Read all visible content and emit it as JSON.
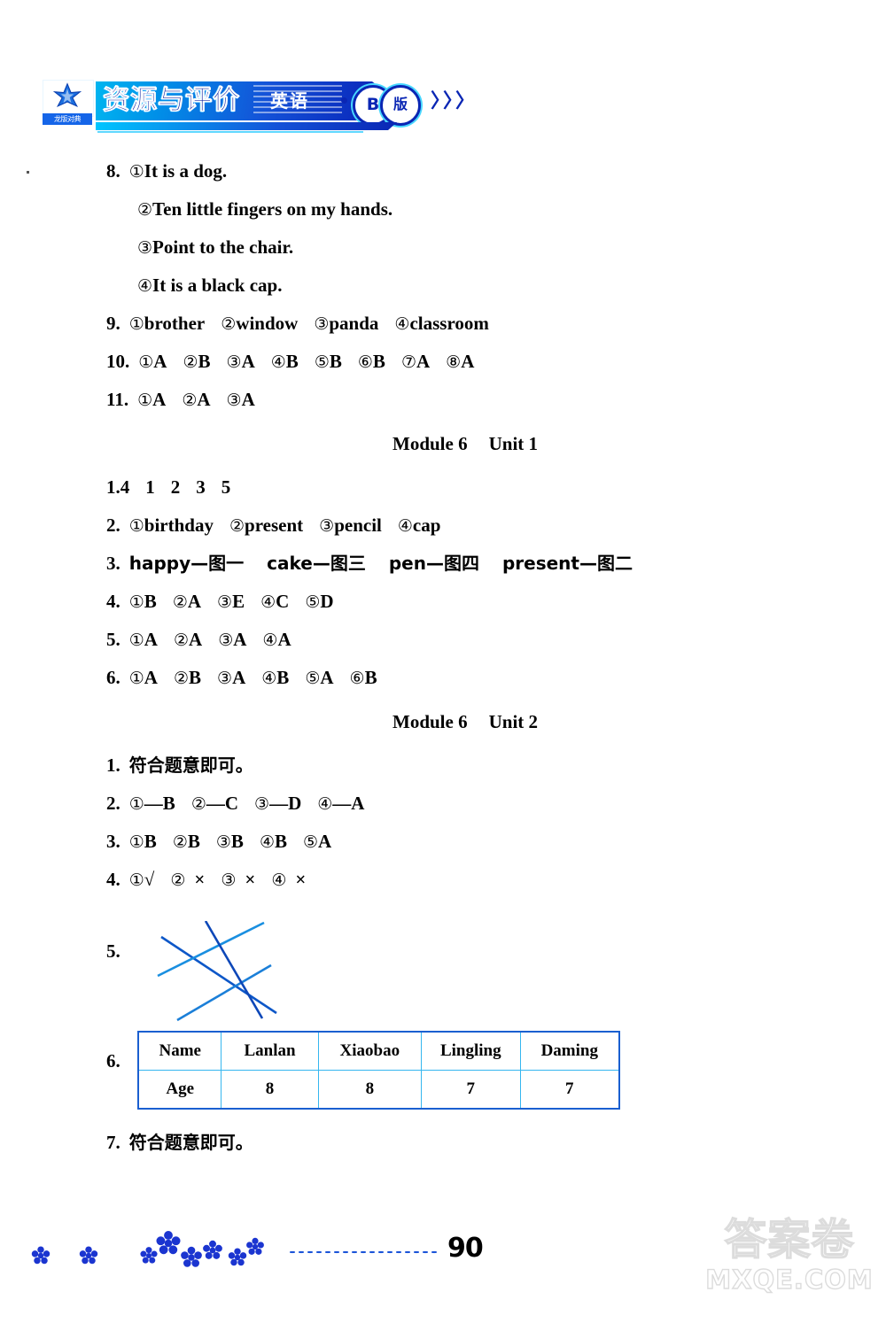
{
  "header": {
    "logo_star": "star-logo",
    "logo_caption": "龙版对典",
    "title": "资源与评价",
    "subject": "英语",
    "badge_b": "B",
    "badge_ban": "版",
    "chevrons": "〉〉〉"
  },
  "answers": {
    "q8": {
      "num": "8.",
      "items": [
        {
          "marker": "①",
          "text": "It is a dog."
        },
        {
          "marker": "②",
          "text": "Ten little fingers on my hands."
        },
        {
          "marker": "③",
          "text": "Point to the chair."
        },
        {
          "marker": "④",
          "text": "It is a black cap."
        }
      ]
    },
    "q9": {
      "num": "9.",
      "items": [
        {
          "marker": "①",
          "text": "brother"
        },
        {
          "marker": "②",
          "text": "window"
        },
        {
          "marker": "③",
          "text": "panda"
        },
        {
          "marker": "④",
          "text": "classroom"
        }
      ]
    },
    "q10": {
      "num": "10.",
      "items": [
        {
          "marker": "①",
          "text": "A"
        },
        {
          "marker": "②",
          "text": "B"
        },
        {
          "marker": "③",
          "text": "A"
        },
        {
          "marker": "④",
          "text": "B"
        },
        {
          "marker": "⑤",
          "text": "B"
        },
        {
          "marker": "⑥",
          "text": "B"
        },
        {
          "marker": "⑦",
          "text": "A"
        },
        {
          "marker": "⑧",
          "text": "A"
        }
      ]
    },
    "q11": {
      "num": "11.",
      "items": [
        {
          "marker": "①",
          "text": "A"
        },
        {
          "marker": "②",
          "text": "A"
        },
        {
          "marker": "③",
          "text": "A"
        }
      ]
    }
  },
  "module6_unit1": {
    "heading_module": "Module 6",
    "heading_unit": "Unit 1",
    "q1": {
      "num": "1.",
      "values": [
        "4",
        "1",
        "2",
        "3",
        "5"
      ]
    },
    "q2": {
      "num": "2.",
      "items": [
        {
          "marker": "①",
          "text": "birthday"
        },
        {
          "marker": "②",
          "text": "present"
        },
        {
          "marker": "③",
          "text": "pencil"
        },
        {
          "marker": "④",
          "text": "cap"
        }
      ]
    },
    "q3": {
      "num": "3.",
      "pairs": [
        "happy—图一",
        "cake—图三",
        "pen—图四",
        "present—图二"
      ]
    },
    "q4": {
      "num": "4.",
      "items": [
        {
          "marker": "①",
          "text": "B"
        },
        {
          "marker": "②",
          "text": "A"
        },
        {
          "marker": "③",
          "text": "E"
        },
        {
          "marker": "④",
          "text": "C"
        },
        {
          "marker": "⑤",
          "text": "D"
        }
      ]
    },
    "q5": {
      "num": "5.",
      "items": [
        {
          "marker": "①",
          "text": "A"
        },
        {
          "marker": "②",
          "text": "A"
        },
        {
          "marker": "③",
          "text": "A"
        },
        {
          "marker": "④",
          "text": "A"
        }
      ]
    },
    "q6": {
      "num": "6.",
      "items": [
        {
          "marker": "①",
          "text": "A"
        },
        {
          "marker": "②",
          "text": "B"
        },
        {
          "marker": "③",
          "text": "A"
        },
        {
          "marker": "④",
          "text": "B"
        },
        {
          "marker": "⑤",
          "text": "A"
        },
        {
          "marker": "⑥",
          "text": "B"
        }
      ]
    }
  },
  "module6_unit2": {
    "heading_module": "Module 6",
    "heading_unit": "Unit 2",
    "q1": {
      "num": "1.",
      "text": "符合题意即可。"
    },
    "q2": {
      "num": "2.",
      "items": [
        {
          "marker": "①",
          "text": "—B"
        },
        {
          "marker": "②",
          "text": "—C"
        },
        {
          "marker": "③",
          "text": "—D"
        },
        {
          "marker": "④",
          "text": "—A"
        }
      ]
    },
    "q3": {
      "num": "3.",
      "items": [
        {
          "marker": "①",
          "text": "B"
        },
        {
          "marker": "②",
          "text": "B"
        },
        {
          "marker": "③",
          "text": "B"
        },
        {
          "marker": "④",
          "text": "B"
        },
        {
          "marker": "⑤",
          "text": "A"
        }
      ]
    },
    "q4": {
      "num": "4.",
      "items": [
        {
          "marker": "①",
          "text": "√"
        },
        {
          "marker": "②",
          "text": "×"
        },
        {
          "marker": "③",
          "text": "×"
        },
        {
          "marker": "④",
          "text": "×"
        }
      ]
    },
    "q5": {
      "num": "5.",
      "figure": "crossed-lines-matching-diagram",
      "line_color": "#1a6fd4"
    },
    "q6": {
      "num": "6.",
      "table": {
        "rows": [
          [
            "Name",
            "Lanlan",
            "Xiaobao",
            "Lingling",
            "Daming"
          ],
          [
            "Age",
            "8",
            "8",
            "7",
            "7"
          ]
        ],
        "border_color": "#1a5fd0",
        "inner_color": "#35b6ef"
      }
    },
    "q7": {
      "num": "7.",
      "text": "符合题意即可。"
    }
  },
  "footer": {
    "flower_count": 8,
    "flower_color": "#1b35d0",
    "page_number": "90"
  },
  "watermark": {
    "cn": "答案卷",
    "en": "MXQE.COM"
  }
}
